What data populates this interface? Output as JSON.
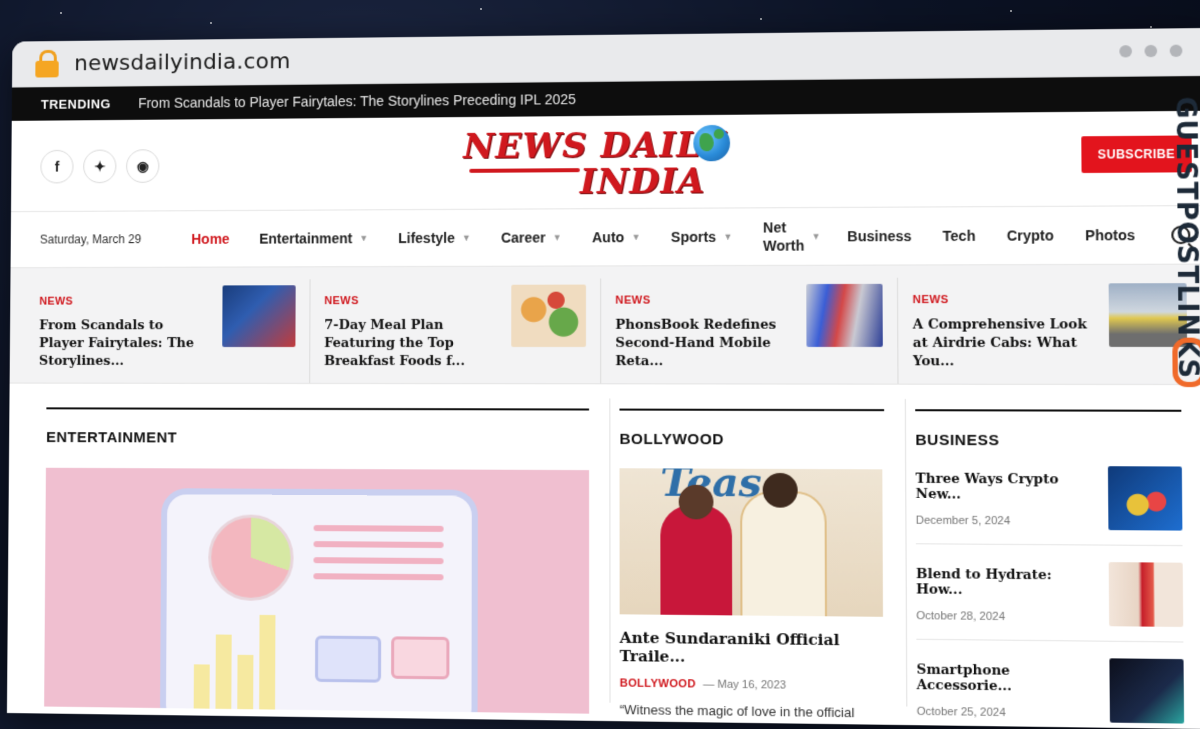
{
  "browser": {
    "url": "newsdailyindia.com"
  },
  "trending": {
    "label": "TRENDING",
    "headline": "From Scandals to Player Fairytales: The Storylines Preceding IPL 2025"
  },
  "header": {
    "logo_line1": "NEWS DAILY",
    "logo_line2": "INDIA",
    "subscribe": "SUBSCRIBE",
    "socials": [
      "f",
      "t",
      "ig"
    ]
  },
  "nav": {
    "date": "Saturday, March 29",
    "items": [
      {
        "label": "Home"
      },
      {
        "label": "Entertainment"
      },
      {
        "label": "Lifestyle"
      },
      {
        "label": "Career"
      },
      {
        "label": "Auto"
      },
      {
        "label": "Sports"
      },
      {
        "label": "Net Worth"
      },
      {
        "label": "Business"
      },
      {
        "label": "Tech"
      },
      {
        "label": "Crypto"
      },
      {
        "label": "Photos"
      }
    ]
  },
  "strip": [
    {
      "cat": "NEWS",
      "title": "From Scandals to Player Fairytales: The Storylines..."
    },
    {
      "cat": "NEWS",
      "title": "7-Day Meal Plan Featuring the Top Breakfast Foods f..."
    },
    {
      "cat": "NEWS",
      "title": "PhonsBook Redefines Second-Hand Mobile Reta..."
    },
    {
      "cat": "NEWS",
      "title": "A Comprehensive Look at Airdrie Cabs: What You..."
    }
  ],
  "sections": {
    "entertainment": {
      "title": "ENTERTAINMENT"
    },
    "bollywood": {
      "title": "BOLLYWOOD",
      "image_text": "Teas",
      "post_title": "Ante Sundaraniki Official Traile...",
      "category": "BOLLYWOOD",
      "date": "— May 16, 2023",
      "excerpt": "“Witness the magic of love in the official"
    },
    "business": {
      "title": "BUSINESS",
      "items": [
        {
          "title": "Three Ways Crypto New...",
          "date": "December 5, 2024"
        },
        {
          "title": "Blend to Hydrate: How...",
          "date": "October 28, 2024"
        },
        {
          "title": "Smartphone Accessorie...",
          "date": "October 25, 2024"
        }
      ]
    }
  },
  "watermark": "GUESTPOSTLINKS"
}
